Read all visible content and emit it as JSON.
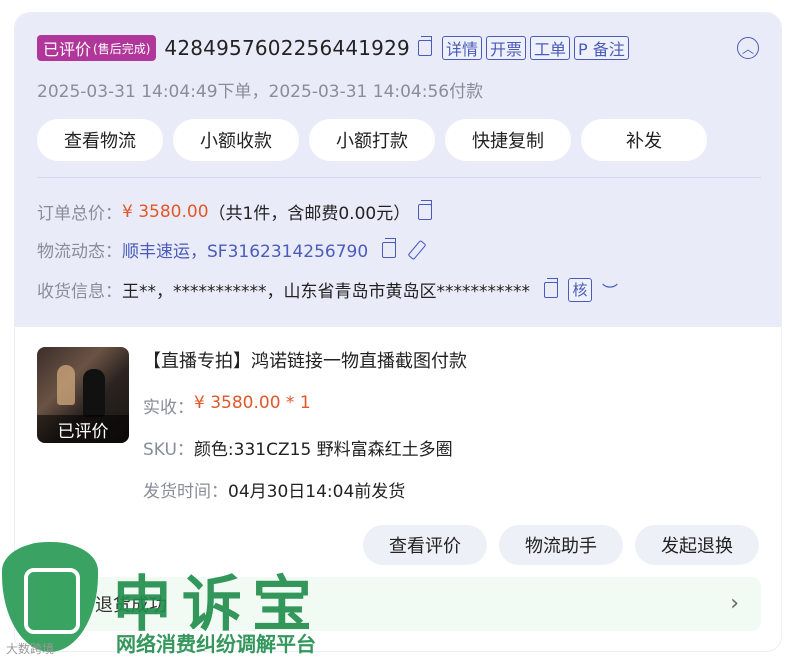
{
  "order": {
    "status_badge": "已评价",
    "status_badge_sub": "(售后完成)",
    "order_number": "4284957602256441929",
    "tags": [
      "详情",
      "开票",
      "工单",
      "P 备注"
    ],
    "times": "2025-03-31 14:04:49下单，2025-03-31 14:04:56付款",
    "buttons": [
      "查看物流",
      "小额收款",
      "小额打款",
      "快捷复制",
      "补发"
    ],
    "total_label": "订单总价：",
    "total_value": "¥ 3580.00",
    "total_note": "（共1件，含邮费0.00元）",
    "logistics_label": "物流动态：",
    "logistics_value": "顺丰速运，SF3162314256790",
    "receiver_label": "收货信息：",
    "receiver_value": "王**，***********，山东省青岛市黄岛区***********",
    "verify_label": "核",
    "icons": [
      "copy-icon",
      "edit-icon",
      "eye-closed-icon",
      "chevron-up-icon"
    ]
  },
  "product": {
    "thumb_caption": "已评价",
    "title": "【直播专拍】鸿诺链接一物直播截图付款",
    "paid_label": "实收：",
    "paid_value": "¥ 3580.00 * 1",
    "sku_label": "SKU：",
    "sku_value": "颜色:331CZ15 野料富森红土多圈",
    "ship_label": "发货时间：",
    "ship_value": "04月30日14:04前发货"
  },
  "actions": [
    "查看评价",
    "物流助手",
    "发起退换"
  ],
  "refund": {
    "label": "退货成功"
  },
  "watermark": {
    "title": "申诉宝",
    "subtitle": "网络消费纠纷调解平台",
    "small": "大数跨境"
  },
  "colors": {
    "badge": "#b0369a",
    "accent_blue": "#4a5bb8",
    "price_red": "#e0572a",
    "watermark_green": "#1f8c4a"
  }
}
